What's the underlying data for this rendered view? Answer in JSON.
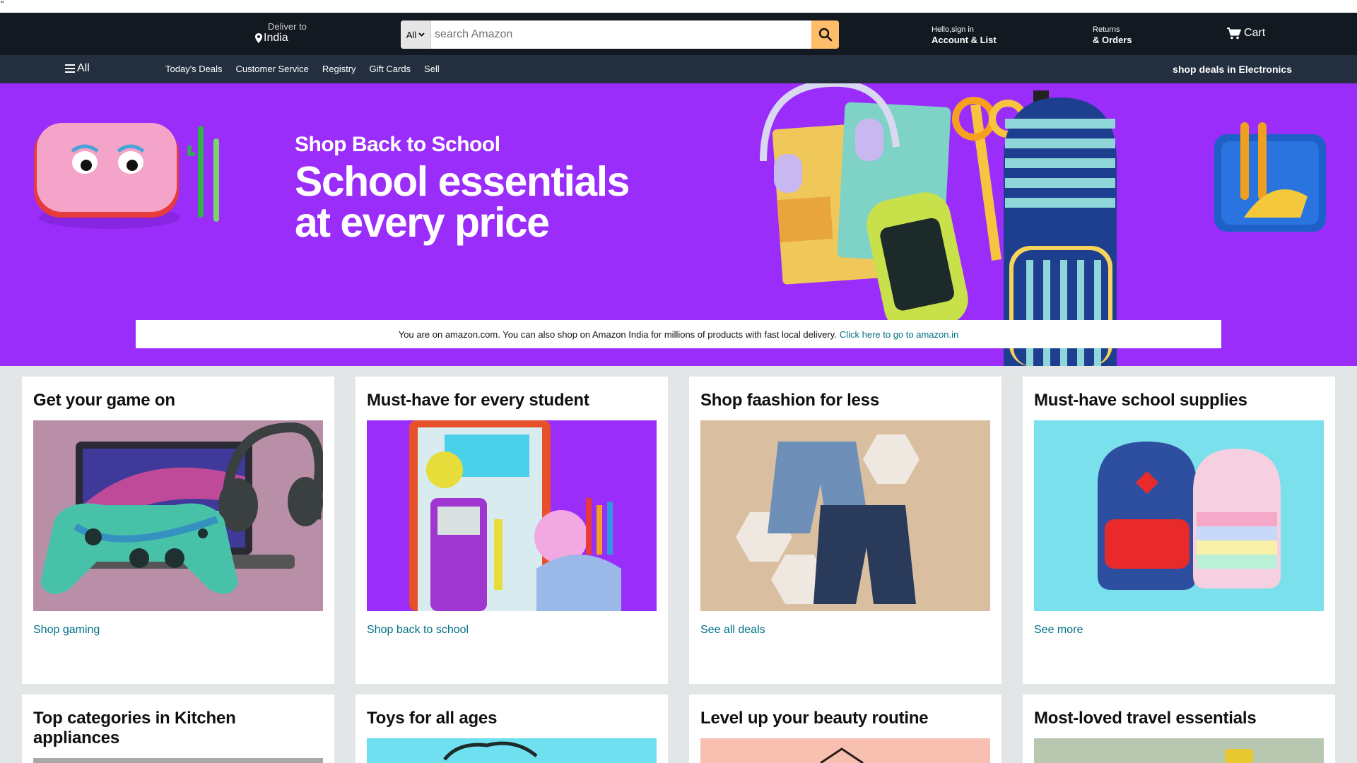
{
  "stray_text": "\"",
  "header": {
    "deliver_label": "Deliver to",
    "deliver_location": "India",
    "search": {
      "category": "All",
      "placeholder": "search Amazon"
    },
    "account_line1": "Hello,sign in",
    "account_line2": "Account & List",
    "returns_line1": "Returns",
    "returns_line2": "& Orders",
    "cart_label": "Cart"
  },
  "subnav": {
    "all_label": "All",
    "links": [
      "Today's Deals",
      "Customer Service",
      "Registry",
      "Gift Cards",
      "Sell"
    ],
    "promo": "shop deals in Electronics"
  },
  "hero": {
    "subtitle": "Shop Back to School",
    "title_line1": "School essentials",
    "title_line2": "at every price",
    "background": "#9b2dfb"
  },
  "notice": {
    "text": "You are on amazon.com. You can also shop on Amazon India for millions of products with fast local delivery.",
    "link": "Click here to go to amazon.in"
  },
  "cards": [
    {
      "title": "Get your game on",
      "link": "Shop gaming"
    },
    {
      "title": "Must-have for every student",
      "link": "Shop back to school"
    },
    {
      "title": "Shop faashion for less",
      "link": "See all deals"
    },
    {
      "title": "Must-have school supplies",
      "link": "See more"
    },
    {
      "title": "Top categories in Kitchen appliances",
      "link": ""
    },
    {
      "title": "Toys for all ages",
      "link": ""
    },
    {
      "title": "Level up your beauty routine",
      "link": ""
    },
    {
      "title": "Most-loved travel essentials",
      "link": ""
    }
  ],
  "colors": {
    "nav_top": "#131921",
    "nav_sub": "#232f3e",
    "search_button": "#febd69",
    "link": "#007185"
  },
  "icons": [
    "location-pin-icon",
    "search-icon",
    "cart-icon",
    "hamburger-icon",
    "dropdown-caret-icon"
  ]
}
